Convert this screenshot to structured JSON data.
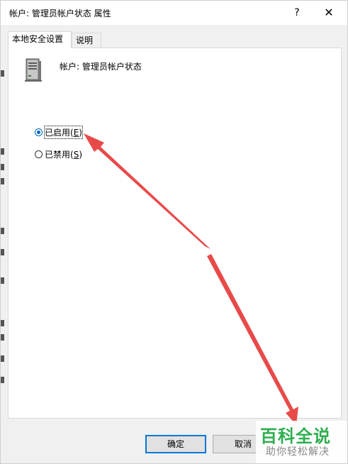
{
  "window": {
    "title": "帐户: 管理员帐户状态 属性",
    "help_glyph": "?",
    "close_glyph": "✕"
  },
  "tabs": [
    {
      "label": "本地安全设置",
      "active": true
    },
    {
      "label": "说明",
      "active": false
    }
  ],
  "policy": {
    "icon": "server-icon",
    "name": "帐户: 管理员帐户状态"
  },
  "options": [
    {
      "label": "已启用",
      "accel": "E",
      "checked": true
    },
    {
      "label": "已禁用",
      "accel": "S",
      "checked": false
    }
  ],
  "buttons": {
    "ok": "确定",
    "cancel": "取消"
  },
  "annotation": {
    "arrow_color": "#e84a4a"
  },
  "watermark": {
    "main": "百科全说",
    "sub": "助你轻松解决",
    "color": "#2eae4f"
  }
}
